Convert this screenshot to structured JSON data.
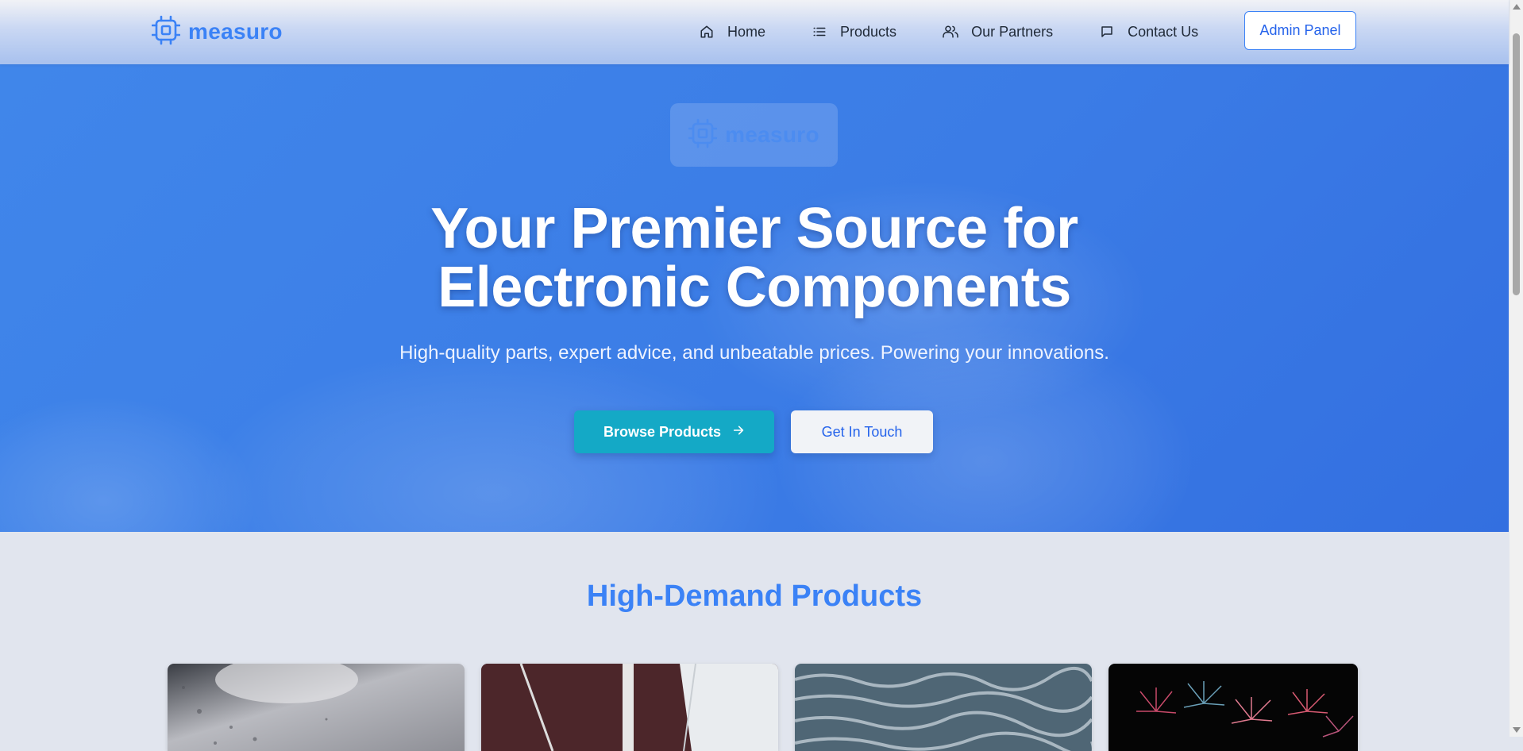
{
  "brand": {
    "name": "measuro",
    "icon": "chip-icon",
    "color": "#3b82f6"
  },
  "nav": {
    "items": [
      {
        "label": "Home",
        "icon": "home-icon"
      },
      {
        "label": "Products",
        "icon": "list-icon"
      },
      {
        "label": "Our Partners",
        "icon": "users-icon"
      },
      {
        "label": "Contact Us",
        "icon": "message-icon"
      }
    ],
    "admin_label": "Admin Panel"
  },
  "hero": {
    "badge_name": "measuro",
    "title_line1": "Your Premier Source for",
    "title_line2": "Electronic Components",
    "subtitle": "High-quality parts, expert advice, and unbeatable prices. Powering your innovations.",
    "primary_button": "Browse Products",
    "secondary_button": "Get In Touch",
    "background_color": "#3b7ce6",
    "primary_color": "#14a9c6"
  },
  "products": {
    "title": "High-Demand Products",
    "cards": [
      {
        "image": "wet-surface-photo"
      },
      {
        "image": "sailboat-photo"
      },
      {
        "image": "ocean-waves-photo"
      },
      {
        "image": "fireworks-photo"
      }
    ]
  }
}
